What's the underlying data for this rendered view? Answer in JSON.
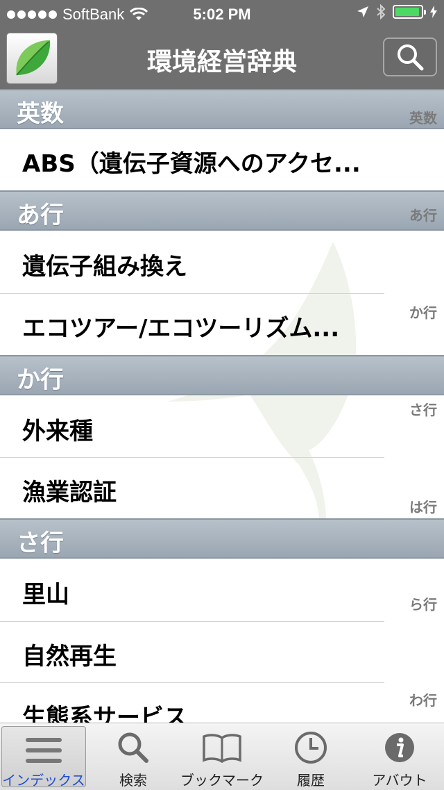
{
  "status_bar": {
    "carrier": "SoftBank",
    "time": "5:02 PM",
    "battery_level": 0.95
  },
  "nav": {
    "title": "環境経営辞典",
    "search_icon": "search-icon",
    "app_icon": "leaf-icon"
  },
  "sections": [
    {
      "title": "英数",
      "rows": [
        "ABS（遺伝子資源へのアクセ..."
      ]
    },
    {
      "title": "あ行",
      "rows": [
        "遺伝子組み換え",
        "エコツアー/エコツーリズム..."
      ]
    },
    {
      "title": "か行",
      "rows": [
        "外来種",
        "漁業認証"
      ]
    },
    {
      "title": "さ行",
      "rows": [
        "里山",
        "自然再生",
        "生態系サービス"
      ]
    }
  ],
  "index": [
    "英数",
    "あ行",
    "か行",
    "さ行",
    "は行",
    "ら行",
    "わ行"
  ],
  "tabs": [
    {
      "label": "インデックス",
      "icon": "list-icon",
      "active": true
    },
    {
      "label": "検索",
      "icon": "search-icon",
      "active": false
    },
    {
      "label": "ブックマーク",
      "icon": "book-icon",
      "active": false
    },
    {
      "label": "履歴",
      "icon": "clock-icon",
      "active": false
    },
    {
      "label": "アバウト",
      "icon": "info-icon",
      "active": false
    }
  ]
}
